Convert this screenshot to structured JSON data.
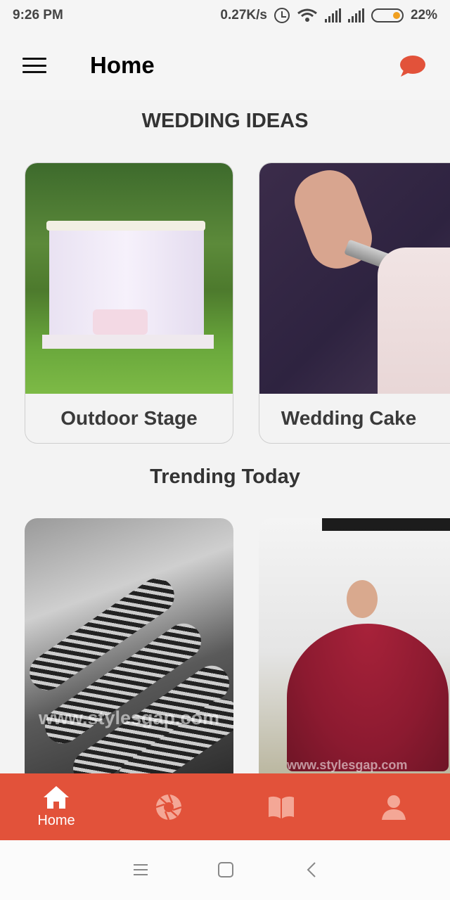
{
  "status_bar": {
    "time": "9:26 PM",
    "network_speed": "0.27K/s",
    "battery_percent": "22%",
    "icons": [
      "alarm-icon",
      "wifi-icon",
      "signal-icon",
      "signal-icon",
      "battery-icon"
    ],
    "battery_level": 0.22,
    "battery_color": "#f0a020"
  },
  "app_bar": {
    "title": "Home",
    "left_icon": "menu-icon",
    "right_icon": "chat-icon",
    "accent": "#e2523a"
  },
  "wedding_ideas": {
    "title": "WEDDING IDEAS",
    "cards": [
      {
        "label": "Outdoor Stage",
        "image": "outdoor-stage-photo"
      },
      {
        "label": "Wedding Cake",
        "image": "wedding-cake-photo"
      }
    ]
  },
  "trending": {
    "title": "Trending Today",
    "cards": [
      {
        "image": "mehndi-hands-photo",
        "watermark": "www.stylesgap.com"
      },
      {
        "image": "bridal-dress-photo",
        "watermark": "www.stylesgap.com"
      }
    ]
  },
  "bottom_nav": {
    "background": "#e2523a",
    "items": [
      {
        "label": "Home",
        "icon": "home-icon",
        "active": true
      },
      {
        "label": "",
        "icon": "camera-shutter-icon",
        "active": false
      },
      {
        "label": "",
        "icon": "book-icon",
        "active": false
      },
      {
        "label": "",
        "icon": "profile-icon",
        "active": false
      }
    ]
  },
  "system_nav": {
    "buttons": [
      "recents-icon",
      "home-square-icon",
      "back-icon"
    ]
  }
}
